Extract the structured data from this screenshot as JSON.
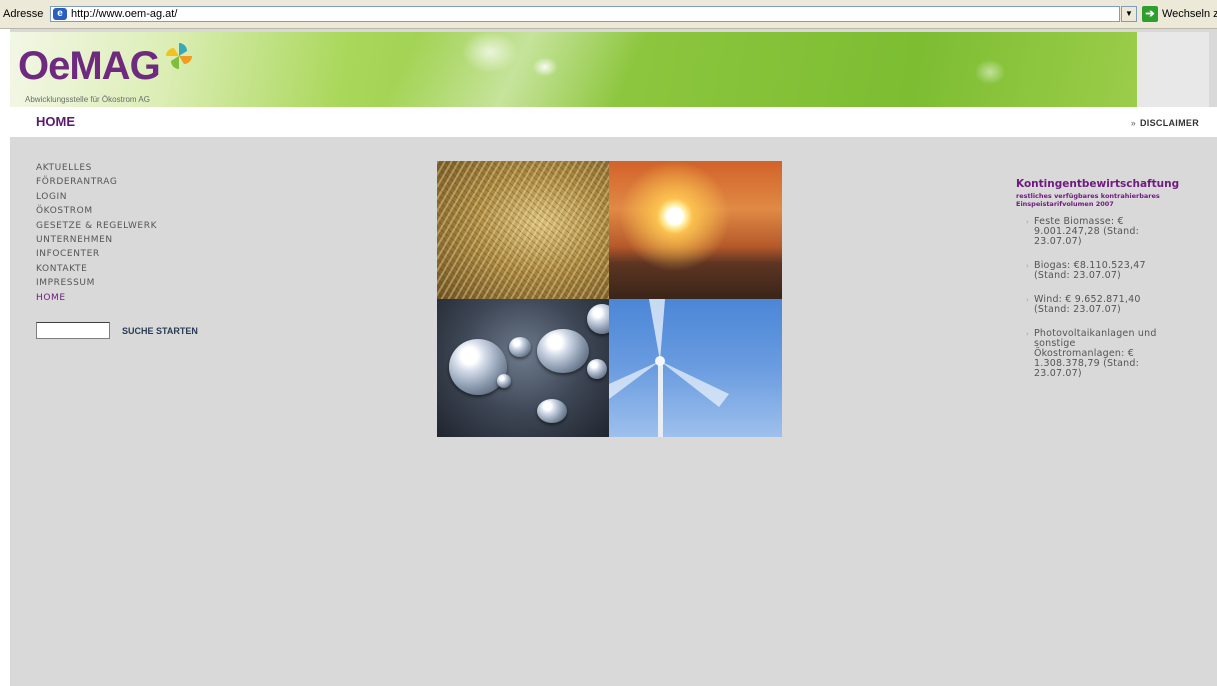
{
  "browser": {
    "address_label": "Adresse",
    "url": "http://www.oem-ag.at/",
    "go_label": "Wechseln zu"
  },
  "header": {
    "logo_text": "OeMAG",
    "logo_subtitle": "Abwicklungsstelle für Ökostrom AG",
    "page_title": "HOME",
    "disclaimer_label": "DISCLAIMER",
    "disclaimer_bullet": "»"
  },
  "nav": {
    "items": [
      "AKTUELLES",
      "FÖRDERANTRAG",
      "LOGIN",
      "ÖKOSTROM",
      "GESETZE & REGELWERK",
      "UNTERNEHMEN",
      "INFOCENTER",
      "KONTAKTE",
      "IMPRESSUM",
      "HOME"
    ],
    "active_index": 9
  },
  "search": {
    "value": "",
    "button_label": "SUCHE STARTEN"
  },
  "info_panel": {
    "title": "Kontingentbewirtschaftung",
    "subtitle": "restliches verfügbares kontrahierbares Einspeistarifvolumen 2007",
    "bullet": "›",
    "items": [
      "Feste Biomasse: € 9.001.247,28 (Stand: 23.07.07)",
      "Biogas: €8.110.523,47 (Stand: 23.07.07)",
      "Wind: € 9.652.871,40 (Stand: 23.07.07)",
      "Photovoltaikanlagen und sonstige Ökostromanlagen: € 1.308.378,79 (Stand: 23.07.07)"
    ]
  },
  "colors": {
    "brand_purple": "#6e1a7e",
    "banner_green": "#8cc63e",
    "page_background": "#d9d9d9"
  }
}
